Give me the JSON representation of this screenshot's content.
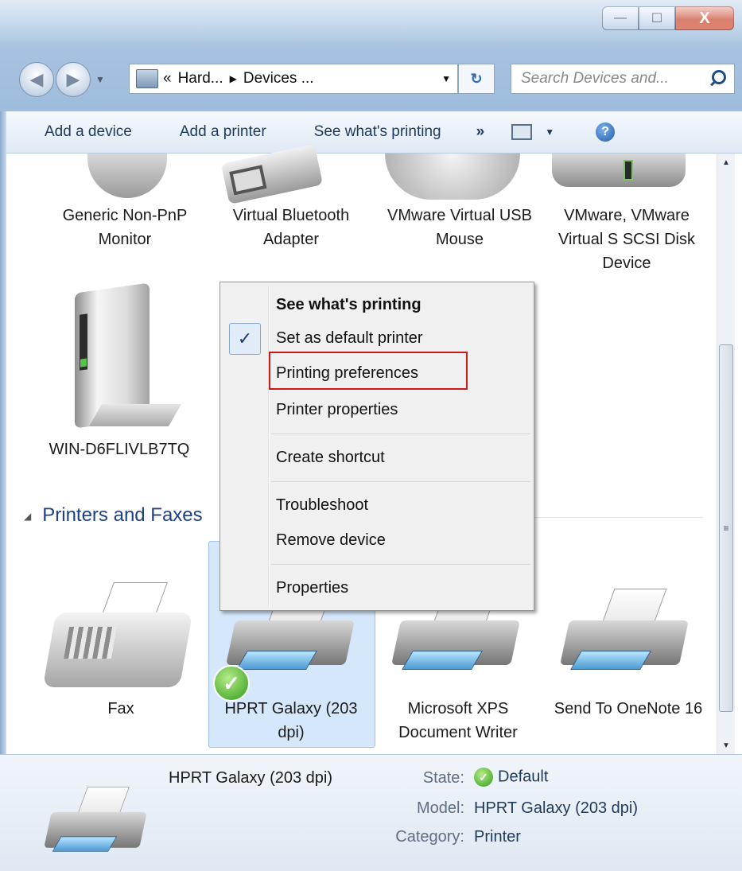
{
  "window": {
    "minimize_glyph": "—",
    "maximize_glyph": "☐",
    "close_glyph": "X"
  },
  "address": {
    "chevron": "«",
    "seg1": "Hard...",
    "sep": "▶",
    "seg2": "Devices ...",
    "dropdown": "▼"
  },
  "search": {
    "placeholder": "Search Devices and..."
  },
  "toolbar": {
    "add_device": "Add a device",
    "add_printer": "Add a printer",
    "see_printing": "See what's printing",
    "more": "»",
    "view_dropdown": "▼",
    "help": "?"
  },
  "devices": [
    {
      "label": "Generic Non-PnP Monitor"
    },
    {
      "label": "Virtual Bluetooth Adapter"
    },
    {
      "label": "VMware Virtual USB Mouse"
    },
    {
      "label": "VMware, VMware Virtual S SCSI Disk Device"
    },
    {
      "label": "WIN-D6FLIVLB7TQ"
    }
  ],
  "group": {
    "title": "Printers and Faxes",
    "collapse_glyph": "◢"
  },
  "printers": [
    {
      "label": "Fax"
    },
    {
      "label": "HPRT Galaxy (203 dpi)"
    },
    {
      "label": "Microsoft XPS Document Writer"
    },
    {
      "label": "Send To OneNote 16"
    }
  ],
  "context_menu": {
    "items": [
      {
        "label": "See what's printing"
      },
      {
        "label": "Set as default printer"
      },
      {
        "label": "Printing preferences"
      },
      {
        "label": "Printer properties"
      },
      {
        "label": "Create shortcut"
      },
      {
        "label": "Troubleshoot"
      },
      {
        "label": "Remove device"
      },
      {
        "label": "Properties"
      }
    ],
    "check_glyph": "✓"
  },
  "details": {
    "name": "HPRT Galaxy (203 dpi)",
    "state_label": "State:",
    "state_value": "Default",
    "model_label": "Model:",
    "model_value": "HPRT Galaxy (203 dpi)",
    "category_label": "Category:",
    "category_value": "Printer"
  },
  "scrollbar": {
    "up": "▲",
    "down": "▼",
    "grip": "≡"
  },
  "colors": {
    "accent": "#1e3f8a",
    "highlight_border": "#c91919",
    "selection": "#d5e8fb"
  }
}
